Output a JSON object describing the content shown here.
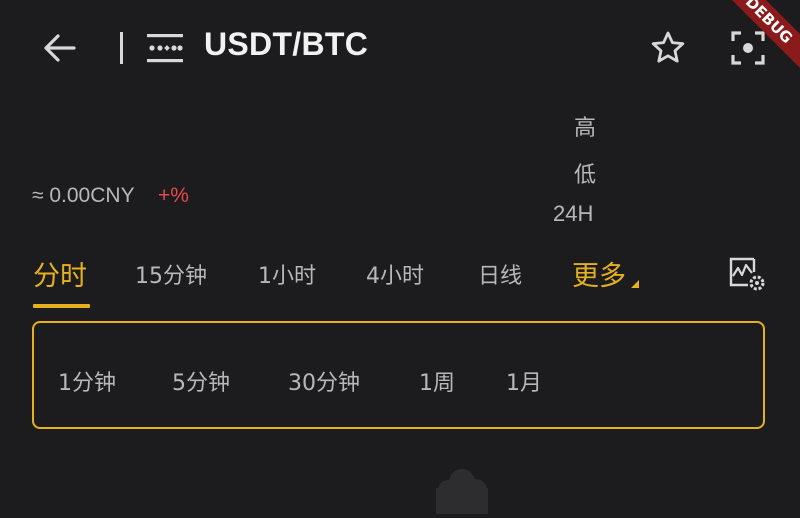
{
  "header": {
    "pair": "USDT/BTC",
    "back_icon": "arrow-left-icon",
    "menu_icon": "drawer-menu-icon",
    "favorite_icon": "star-outline-icon",
    "fullscreen_icon": "scan-frame-icon"
  },
  "debug_banner": "DEBUG",
  "ticker": {
    "approx_price": "≈ 0.00CNY",
    "change": "+%",
    "high_label": "高",
    "low_label": "低",
    "volume_label": "24H"
  },
  "tabs": [
    {
      "label": "分时",
      "active": true
    },
    {
      "label": "15分钟"
    },
    {
      "label": "1小时"
    },
    {
      "label": "4小时"
    },
    {
      "label": "日线"
    },
    {
      "label": "更多"
    }
  ],
  "chart_settings_icon": "chart-settings-icon",
  "more_intervals": [
    "1分钟",
    "5分钟",
    "30分钟",
    "1周",
    "1月"
  ],
  "colors": {
    "background": "#1c1c1e",
    "accent": "#e6b01e",
    "negative": "#e84a4a",
    "muted_text": "#b8b8b8"
  },
  "loading_icon": "cloud-icon"
}
